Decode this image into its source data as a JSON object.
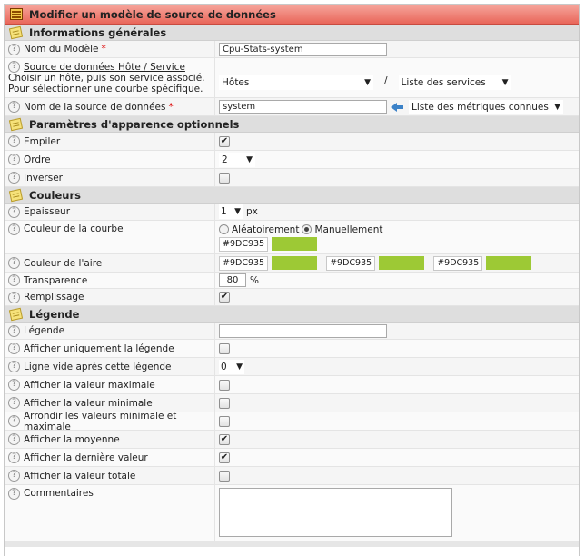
{
  "title": "Modifier un modèle de source de données",
  "sections": {
    "general": "Informations générales",
    "appearance": "Paramètres d'apparence optionnels",
    "colors": "Couleurs",
    "legend": "Légende"
  },
  "help_glyph": "?",
  "required_mark": "*",
  "general": {
    "name_label": "Nom du Modèle",
    "name_value": "Cpu-Stats-system",
    "source_label": "Source de données Hôte / Service",
    "source_help_line1": "Choisir un hôte, puis son service associé.",
    "source_help_line2": "Pour sélectionner une courbe spécifique.",
    "host_select": "Hôtes",
    "separator": "/",
    "service_select": "Liste des services",
    "ds_label": "Nom de la source de données",
    "ds_value": "system",
    "metrics_select": "Liste des métriques connues"
  },
  "appearance": {
    "stack_label": "Empiler",
    "stack_checked": true,
    "order_label": "Ordre",
    "order_value": "2",
    "invert_label": "Inverser",
    "invert_checked": false
  },
  "colors": {
    "thickness_label": "Epaisseur",
    "thickness_value": "1",
    "thickness_unit": "px",
    "curve_label": "Couleur de la courbe",
    "random_label": "Aléatoirement",
    "manual_label": "Manuellement",
    "manual_selected": true,
    "curve_hex": "#9DC935",
    "area_label": "Couleur de l'aire",
    "area_hex": [
      "#9DC935",
      "#9DC935",
      "#9DC935"
    ],
    "swatch_color": "#9DC935",
    "transparency_label": "Transparence",
    "transparency_value": "80",
    "transparency_unit": "%",
    "fill_label": "Remplissage",
    "fill_checked": true
  },
  "legend": {
    "legend_label": "Légende",
    "legend_value": "",
    "rows": [
      {
        "label": "Afficher uniquement la légende",
        "checked": false
      },
      {
        "label": "Ligne vide après cette légende",
        "select": "0"
      },
      {
        "label": "Afficher la valeur maximale",
        "checked": false
      },
      {
        "label": "Afficher la valeur minimale",
        "checked": false
      },
      {
        "label": "Arrondir les valeurs minimale et maximale",
        "checked": false
      },
      {
        "label": "Afficher la moyenne",
        "checked": true
      },
      {
        "label": "Afficher la dernière valeur",
        "checked": true
      },
      {
        "label": "Afficher la valeur totale",
        "checked": false
      }
    ],
    "comments_label": "Commentaires",
    "comments_value": ""
  },
  "check_glyph": "✔"
}
